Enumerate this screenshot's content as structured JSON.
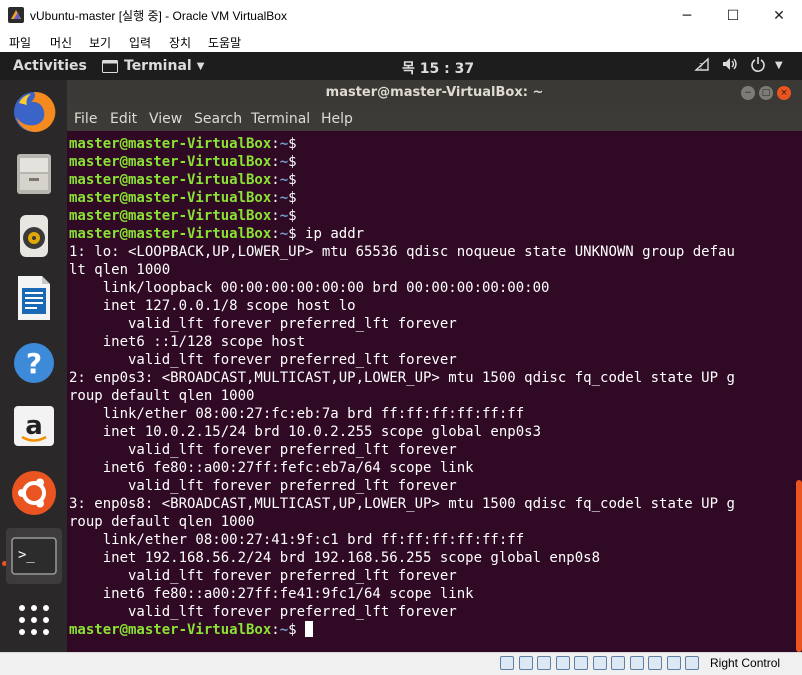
{
  "host_window": {
    "title": "vUbuntu-master [실행 중] - Oracle VM VirtualBox",
    "minimize_label": "─",
    "maximize_label": "☐",
    "close_label": "✕"
  },
  "vbox_menu": [
    "파일",
    "머신",
    "보기",
    "입력",
    "장치",
    "도움말"
  ],
  "top_bar": {
    "activities": "Activities",
    "app_menu": "Terminal",
    "clock": "목 15 : 37",
    "status_icons": [
      "network-icon",
      "volume-icon",
      "power-icon"
    ]
  },
  "dock": {
    "items": [
      "firefox-icon",
      "files-icon",
      "rhythmbox-icon",
      "libreoffice-writer-icon",
      "help-icon",
      "amazon-icon",
      "ubuntu-software-icon",
      "terminal-icon",
      "show-applications-icon"
    ],
    "active": "terminal-icon"
  },
  "terminal": {
    "window_title": "master@master-VirtualBox: ~",
    "menu": [
      "File",
      "Edit",
      "View",
      "Search",
      "Terminal",
      "Help"
    ],
    "prompt_user": "master@master-VirtualBox",
    "prompt_path": "~",
    "prompt_sep": ":",
    "prompt_symbol": "$",
    "command": "ip addr",
    "output": [
      "1: lo: <LOOPBACK,UP,LOWER_UP> mtu 65536 qdisc noqueue state UNKNOWN group defau",
      "lt qlen 1000",
      "    link/loopback 00:00:00:00:00:00 brd 00:00:00:00:00:00",
      "    inet 127.0.0.1/8 scope host lo",
      "       valid_lft forever preferred_lft forever",
      "    inet6 ::1/128 scope host",
      "       valid_lft forever preferred_lft forever",
      "2: enp0s3: <BROADCAST,MULTICAST,UP,LOWER_UP> mtu 1500 qdisc fq_codel state UP g",
      "roup default qlen 1000",
      "    link/ether 08:00:27:fc:eb:7a brd ff:ff:ff:ff:ff:ff",
      "    inet 10.0.2.15/24 brd 10.0.2.255 scope global enp0s3",
      "       valid_lft forever preferred_lft forever",
      "    inet6 fe80::a00:27ff:fefc:eb7a/64 scope link",
      "       valid_lft forever preferred_lft forever",
      "3: enp0s8: <BROADCAST,MULTICAST,UP,LOWER_UP> mtu 1500 qdisc fq_codel state UP g",
      "roup default qlen 1000",
      "    link/ether 08:00:27:41:9f:c1 brd ff:ff:ff:ff:ff:ff",
      "    inet 192.168.56.2/24 brd 192.168.56.255 scope global enp0s8",
      "       valid_lft forever preferred_lft forever",
      "    inet6 fe80::a00:27ff:fe41:9fc1/64 scope link",
      "       valid_lft forever preferred_lft forever"
    ]
  },
  "status_bar": {
    "icons": [
      "hard-disk-icon",
      "optical-drive-icon",
      "audio-icon",
      "network-icon",
      "usb-icon",
      "shared-folder-icon",
      "display-icon",
      "video-capture-icon",
      "cpu-icon",
      "mouse-integration-icon",
      "keyboard-icon"
    ],
    "host_key": "Right Control"
  },
  "colors": {
    "terminal_bg": "#300a24",
    "prompt_user": "#8ae234",
    "prompt_path": "#729fcf",
    "accent": "#e95420",
    "dock_bg": "#2b2829"
  }
}
